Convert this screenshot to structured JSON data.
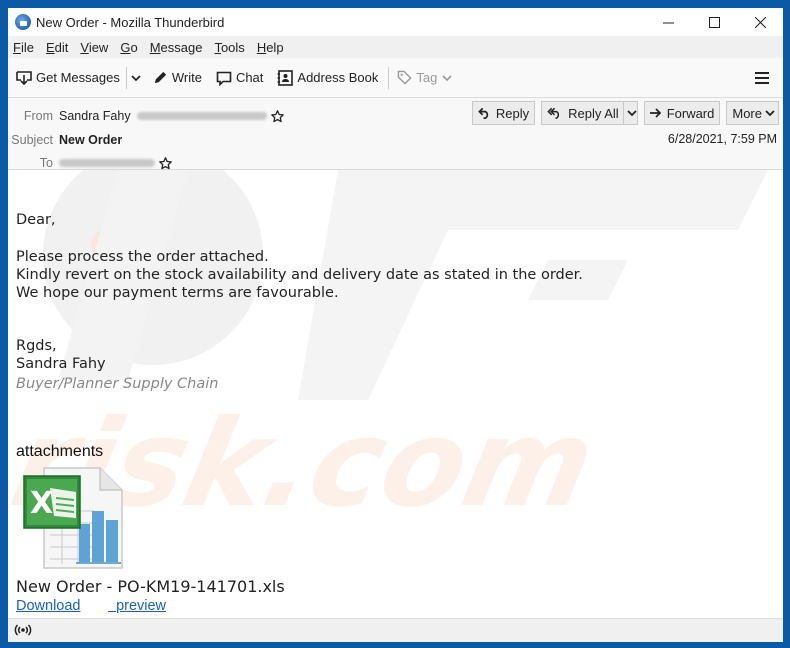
{
  "window": {
    "title": "New Order - Mozilla Thunderbird",
    "controls": {
      "minimize": "—",
      "maximize": "☐",
      "close": "✕"
    }
  },
  "menubar": [
    {
      "key": "F",
      "rest": "ile"
    },
    {
      "key": "E",
      "rest": "dit"
    },
    {
      "key": "V",
      "rest": "iew"
    },
    {
      "key": "G",
      "rest": "o"
    },
    {
      "key": "M",
      "rest": "essage"
    },
    {
      "key": "T",
      "rest": "ools"
    },
    {
      "key": "H",
      "rest": "elp"
    }
  ],
  "toolbar": {
    "get_messages": "Get Messages",
    "write": "Write",
    "chat": "Chat",
    "address_book": "Address Book",
    "tag": "Tag"
  },
  "header": {
    "from_label": "From",
    "from_name": "Sandra Fahy",
    "subject_label": "Subject",
    "subject": "New Order",
    "to_label": "To",
    "date": "6/28/2021, 7:59 PM",
    "buttons": {
      "reply": "Reply",
      "reply_all": "Reply All",
      "forward": "Forward",
      "more": "More"
    }
  },
  "message": {
    "greeting": "Dear,",
    "lines": [
      "Please process the order attached.",
      "Kindly revert on the stock availability and delivery date as stated in the order.",
      "We hope our payment terms are favourable."
    ],
    "closing": "Rgds,",
    "signature_name": "Sandra Fahy",
    "signature_title": "Buyer/Planner Supply Chain",
    "attachments_heading": "attachments",
    "attachment_name": "New Order - PO-KM19-141701.xls",
    "download_label": "Download",
    "preview_label": "preview"
  },
  "watermark": {
    "text": "risk.com",
    "brand": "PC"
  }
}
